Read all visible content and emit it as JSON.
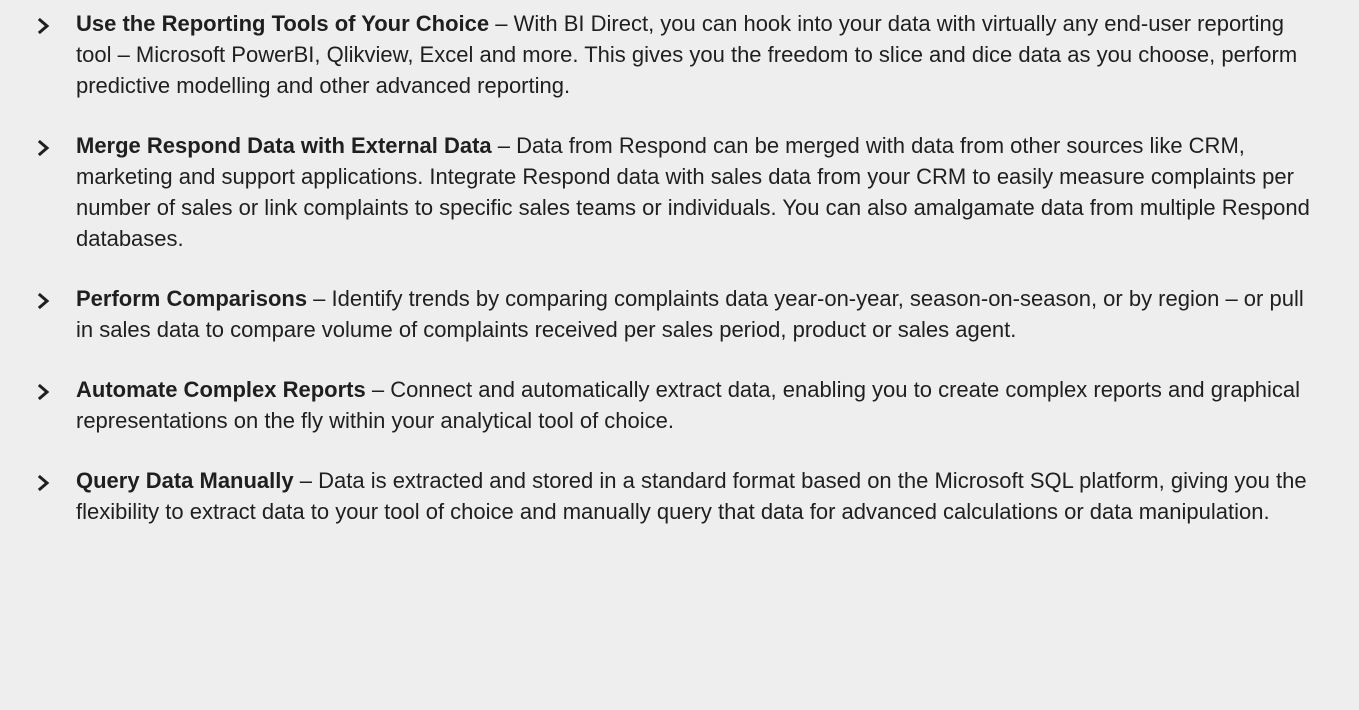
{
  "bullet_icon": "chevron-right-icon",
  "colors": {
    "background": "#eeeeee",
    "text": "#1f1f1f"
  },
  "features": [
    {
      "title": "Use the Reporting Tools of Your Choice",
      "separator": " – ",
      "body": "With BI Direct, you can hook into your data with virtually any end-user reporting tool – Microsoft PowerBI, Qlikview, Excel and more. This gives you the freedom to slice and dice data as you choose, perform predictive modelling and other advanced reporting."
    },
    {
      "title": "Merge Respond Data with External Data",
      "separator": " – ",
      "body": "Data from Respond can be merged with data from other sources like CRM, marketing and support applications. Integrate Respond data with sales data from your CRM to easily measure complaints per number of sales or link complaints to specific sales teams or individuals. You can also amalgamate data from multiple Respond databases."
    },
    {
      "title": "Perform Comparisons",
      "separator": " – ",
      "body": "Identify trends by comparing complaints data year-on-year, season-on-season, or by region – or pull in sales data to compare volume of complaints received per sales period, product or sales agent."
    },
    {
      "title": "Automate Complex Reports",
      "separator": " – ",
      "body": "Connect and automatically extract data, enabling you to create complex reports and graphical representations on the fly within your analytical tool of choice."
    },
    {
      "title": "Query Data Manually",
      "separator": " – ",
      "body": "Data is extracted and stored in a standard format based on the Microsoft SQL platform, giving you the flexibility to extract data to your tool of choice and manually query that data for advanced calculations or data manipulation."
    }
  ]
}
